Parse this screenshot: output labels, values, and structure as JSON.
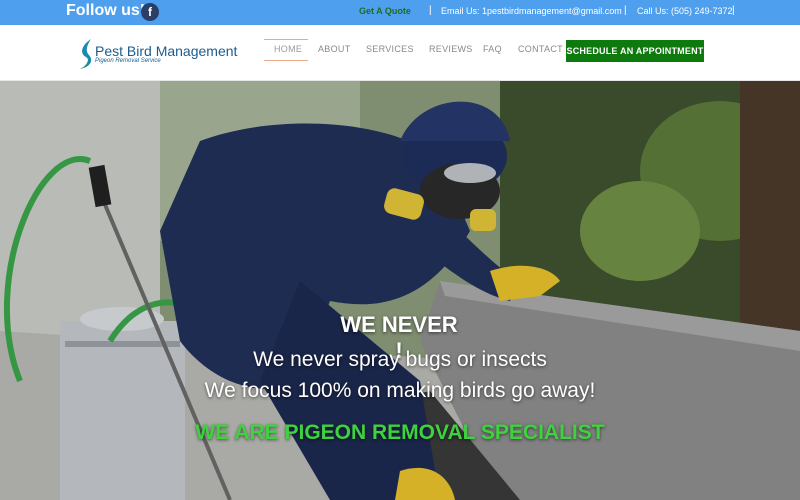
{
  "topbar": {
    "follow_label": "Follow us!",
    "facebook_glyph": "f",
    "quote_label": "Get A Quote",
    "email_label": "Email Us: 1pestbirdmanagement@gmail.com",
    "phone_label": "Call Us: (505) 249-7372",
    "separator": "|",
    "bg_color": "#4ea0ef"
  },
  "brand": {
    "name": "Pest Bird Management",
    "tagline": "Pigeon Removal Service"
  },
  "nav": {
    "items": [
      {
        "label": "HOME",
        "active": true
      },
      {
        "label": "ABOUT"
      },
      {
        "label": "SERVICES"
      },
      {
        "label": "REVIEWS"
      },
      {
        "label": "FAQ"
      },
      {
        "label": "CONTACT"
      }
    ],
    "cta_label": "SCHEDULE AN APPOINTMENT",
    "cta_color": "#0e7a0e"
  },
  "hero": {
    "headline": "WE NEVER !",
    "line1": "We never spray bugs or insects",
    "line2": "We focus 100% on making birds go away!",
    "tagline": "WE ARE PIGEON REMOVAL SPECIALIST",
    "tagline_color": "#3fd13f"
  }
}
